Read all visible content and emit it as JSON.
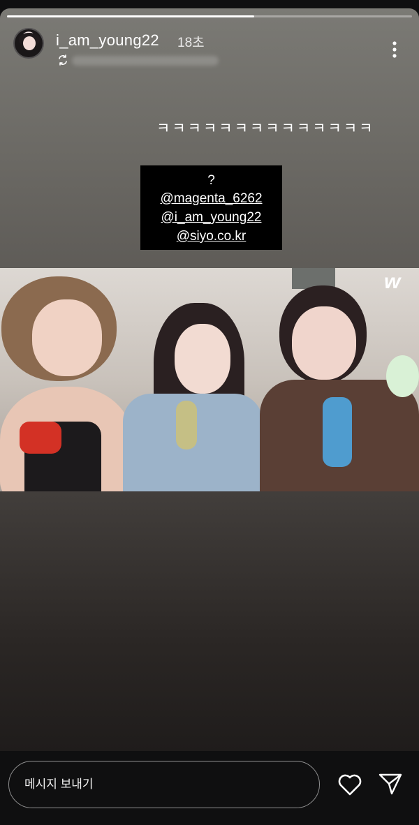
{
  "story": {
    "progress": 0.61,
    "username": "i_am_young22",
    "time_ago": "18초",
    "caption": "ㅋㅋㅋㅋㅋㅋㅋㅋㅋㅋㅋㅋㅋㅋ",
    "tags": {
      "question": "?",
      "mentions": [
        "@magenta_6262",
        "@i_am_young22",
        "@siyo.co.kr"
      ]
    },
    "video_watermark": "w"
  },
  "reply": {
    "placeholder": "메시지 보내기"
  },
  "icons": {
    "repost": "repost-icon",
    "more": "more-options-icon",
    "like": "heart-icon",
    "share": "send-icon"
  }
}
